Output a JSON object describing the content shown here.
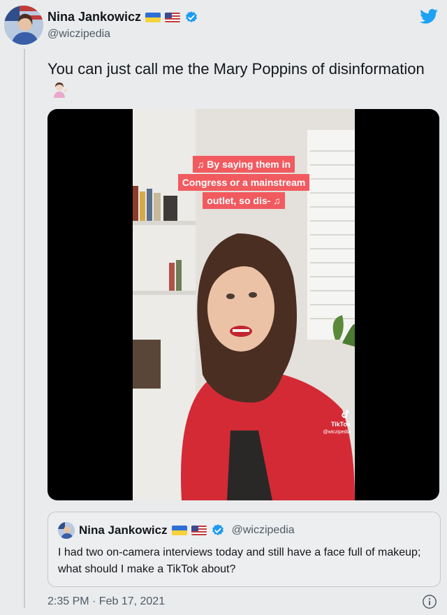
{
  "author": {
    "display_name": "Nina Jankowicz",
    "handle": "@wiczipedia",
    "flags": [
      "ukraine-flag-icon",
      "us-flag-icon"
    ],
    "verified": true
  },
  "tweet": {
    "text": "You can just call me the Mary Poppins of disinformation",
    "emoji": "woman-tipping-hand-emoji"
  },
  "video": {
    "caption_lines": [
      "♫ By saying them in",
      "Congress or a mainstream",
      "outlet, so dis- ♫"
    ],
    "watermark": "TikTok",
    "watermark_handle": "@wiczipedia"
  },
  "quoted_tweet": {
    "display_name": "Nina Jankowicz",
    "handle": "@wiczipedia",
    "text": "I had two on-camera interviews today and still have a face full of makeup; what should I make a TikTok about?"
  },
  "meta": {
    "timestamp": "2:35 PM · Feb 17, 2021"
  },
  "colors": {
    "twitter_blue": "#1da1f2",
    "verified_blue": "#1d9bf0",
    "caption_bg": "#f15a5f",
    "jacket_red": "#d42a35"
  }
}
